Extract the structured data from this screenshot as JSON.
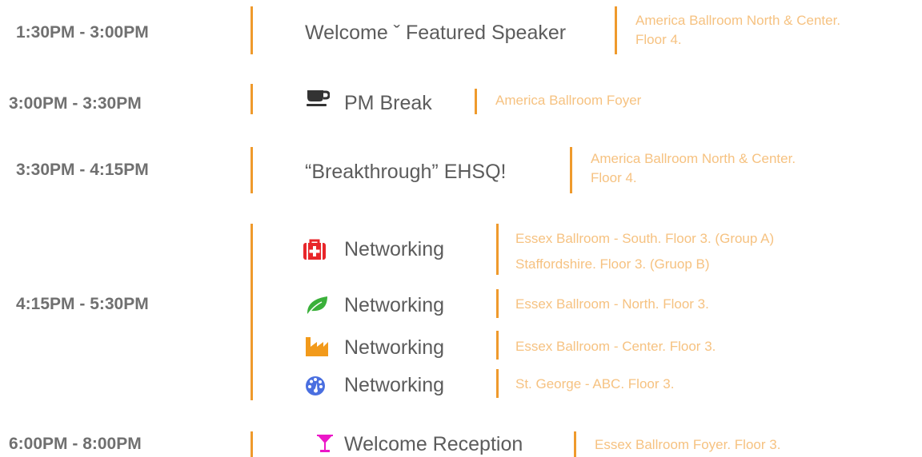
{
  "sessions": [
    {
      "time": "1:30PM - 3:00PM",
      "title": "Welcome ˇ Featured Speaker",
      "location": [
        "America Ballroom North & Center.",
        "Floor 4."
      ]
    },
    {
      "time": "3:00PM - 3:30PM",
      "icon": "coffee-cup-icon",
      "title": "PM Break",
      "location": [
        "America Ballroom Foyer"
      ]
    },
    {
      "time": "3:30PM - 4:15PM",
      "title": "“Breakthrough” EHSQ!",
      "location": [
        "America Ballroom North & Center.",
        "Floor 4."
      ]
    },
    {
      "time": "4:15PM - 5:30PM",
      "tracks": [
        {
          "icon": "first-aid-kit-icon",
          "icon_color": "#e8262a",
          "title": "Networking",
          "location": [
            "Essex Ballroom - South. Floor 3. (Group A)",
            "Staffordshire. Floor 3. (Gruop B)"
          ]
        },
        {
          "icon": "leaf-icon",
          "icon_color": "#3ab03a",
          "title": "Networking",
          "location": [
            "Essex Ballroom - North. Floor 3."
          ]
        },
        {
          "icon": "factory-icon",
          "icon_color": "#f29a1b",
          "title": "Networking",
          "location": [
            "Essex Ballroom - Center. Floor 3."
          ]
        },
        {
          "icon": "dashboard-gauge-icon",
          "icon_color": "#4a6fe0",
          "title": "Networking",
          "location": [
            "St. George - ABC. Floor 3."
          ]
        }
      ]
    },
    {
      "time": "6:00PM - 8:00PM",
      "icon": "cocktail-glass-icon",
      "icon_color": "#ec17c8",
      "title": "Welcome Reception",
      "location": [
        "Essex Ballroom Foyer. Floor 3."
      ]
    }
  ],
  "colors": {
    "accent_bar": "#ef9a2c",
    "location_text": "#f6c281",
    "time_text": "#707070",
    "title_text": "#5c5c5c"
  }
}
